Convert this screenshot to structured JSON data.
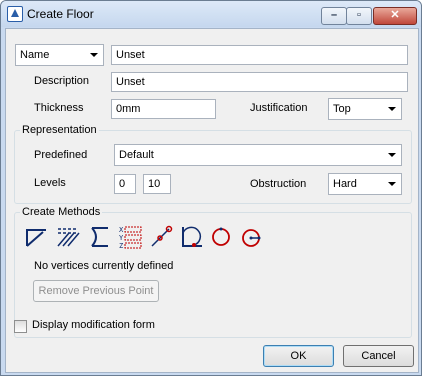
{
  "window": {
    "title": "Create Floor",
    "controls": [
      "minimize-icon",
      "maximize-icon",
      "close-icon"
    ],
    "close_color": "#c0473a"
  },
  "name_row": {
    "type_selected": "Name",
    "value": "Unset"
  },
  "description": {
    "label": "Description",
    "value": "Unset"
  },
  "thickness": {
    "label": "Thickness",
    "value": "0mm"
  },
  "justification": {
    "label": "Justification",
    "value": "Top"
  },
  "representation": {
    "title": "Representation",
    "predefined_label": "Predefined",
    "predefined_value": "Default",
    "levels_label": "Levels",
    "level_from": "0",
    "level_to": "10",
    "obstruction_label": "Obstruction",
    "obstruction_value": "Hard"
  },
  "create_methods": {
    "title": "Create Methods",
    "tools": [
      "two-point-icon",
      "offset-lines-icon",
      "arc-corner-icon",
      "xyz-coordinates-icon",
      "pick-point-icon",
      "angle-arc-icon",
      "circle-icon",
      "circle-center-icon"
    ],
    "status": "No vertices currently defined",
    "remove_label": "Remove Previous Point"
  },
  "display_mod": {
    "label": "Display modification form",
    "checked": false
  },
  "buttons": {
    "ok": "OK",
    "cancel": "Cancel"
  }
}
